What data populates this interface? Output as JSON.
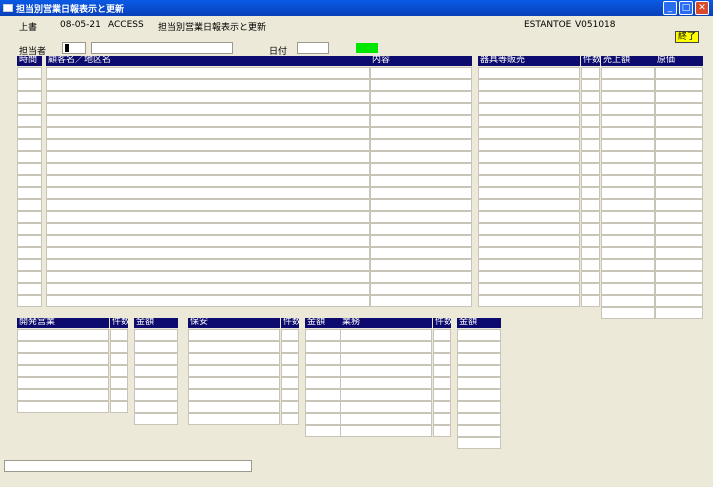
{
  "window": {
    "title": "担当別営業日報表示と更新"
  },
  "header": {
    "mode": "上書",
    "date": "08-05-21",
    "app": "ACCESS",
    "screen_title": "担当別営業日報表示と更新",
    "company": "ESTANTOE",
    "version": "V051018"
  },
  "exit_label": "終了",
  "form": {
    "staff_label": "担当者",
    "date_label": "日付"
  },
  "main_table": {
    "columns": [
      "時間",
      "顧客名／地区名",
      "内容"
    ],
    "row_count": 20
  },
  "sales_table": {
    "columns": [
      "器具等販売",
      "件数",
      "売上額",
      "原価"
    ],
    "row_count": 20
  },
  "sub_tables": [
    {
      "columns": [
        "開発営業",
        "件数",
        "金額"
      ]
    },
    {
      "columns": [
        "保安",
        "件数",
        "金額"
      ]
    },
    {
      "columns": [
        "業務",
        "件数",
        "金額"
      ]
    }
  ],
  "colors": {
    "header_bg": "#0d0b6e",
    "titlebar": "#0a5ae6",
    "exit_bg": "#ffff00",
    "indicator": "#00e600"
  }
}
